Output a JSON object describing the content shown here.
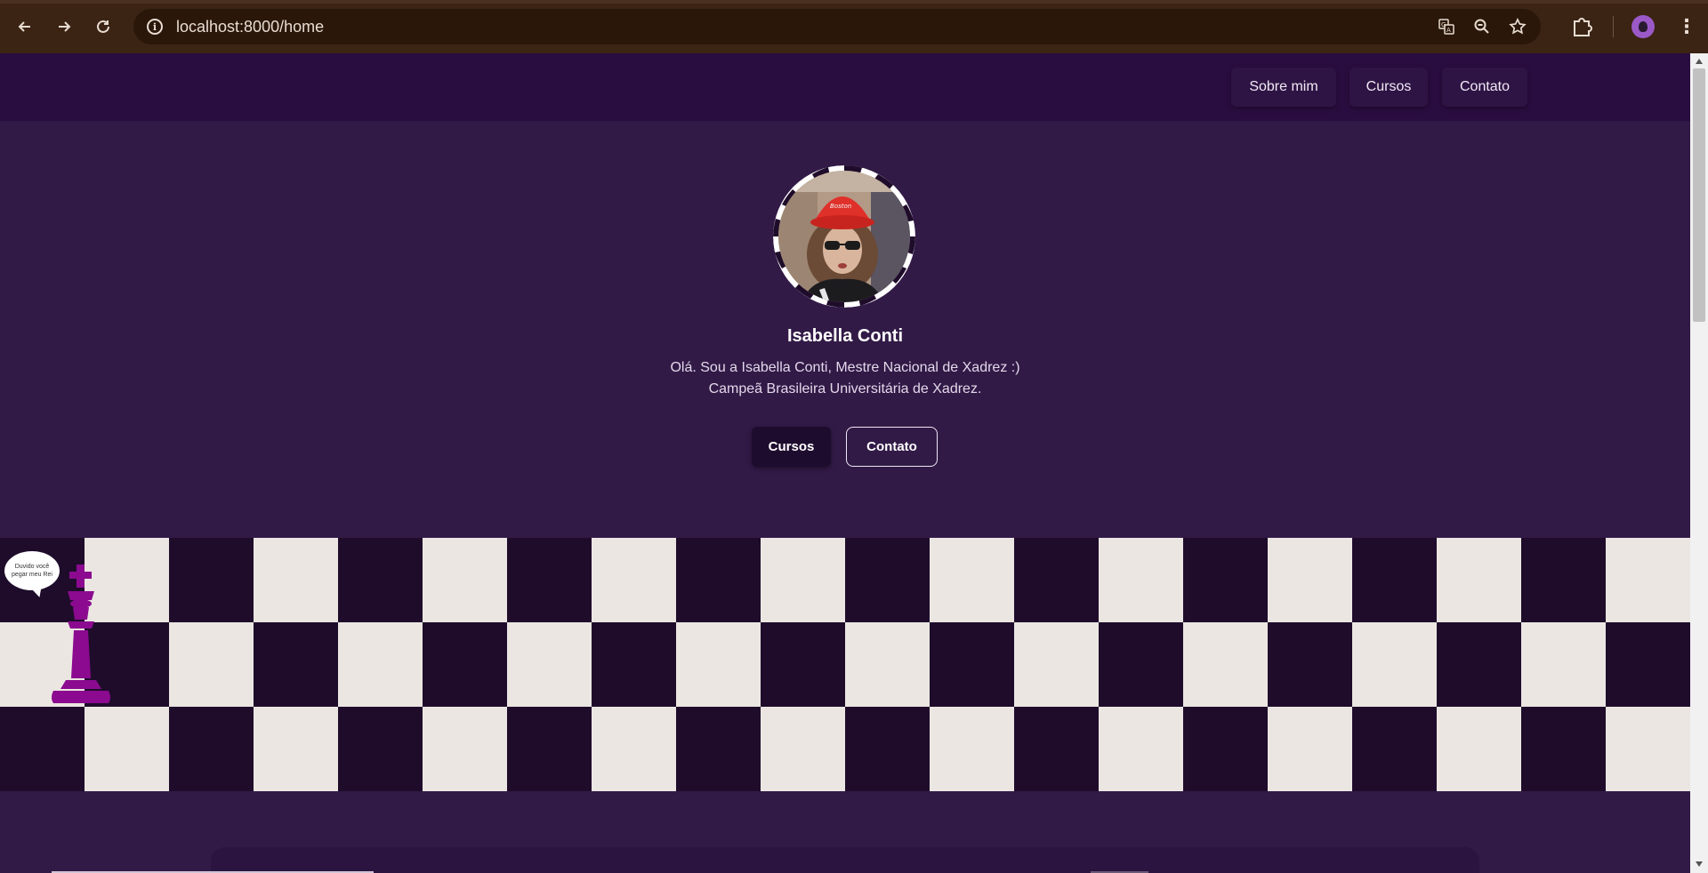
{
  "browser": {
    "url": "localhost:8000/home",
    "icons": [
      "back-icon",
      "forward-icon",
      "reload-icon",
      "site-info-icon",
      "translate-icon",
      "zoom-icon",
      "bookmark-star-icon",
      "extensions-icon",
      "profile-avatar",
      "menu-icon"
    ]
  },
  "nav": {
    "items": [
      "Sobre mim",
      "Cursos",
      "Contato"
    ]
  },
  "hero": {
    "name": "Isabella Conti",
    "line1": "Olá. Sou a Isabella Conti, Mestre Nacional de Xadrez :)",
    "line2": "Campeã Brasileira Universitária de Xadrez.",
    "btn_primary": "Cursos",
    "btn_secondary": "Contato"
  },
  "board": {
    "bubble_text": "Duvido você pegar meu Rei",
    "light_color": "#ebe6e2",
    "dark_color": "#1f0c2b",
    "king_color": "#8b0a8f"
  },
  "colors": {
    "page_bg": "#321a47",
    "nav_bg": "#2a0d40"
  }
}
